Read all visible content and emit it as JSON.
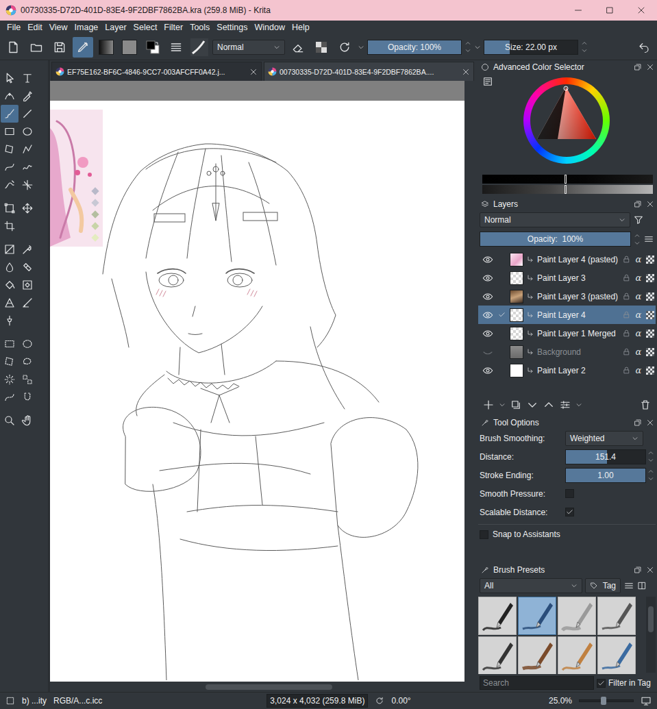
{
  "window": {
    "title": "00730335-D72D-401D-83E4-9F2DBF7862BA.kra (259.8 MiB) - Krita"
  },
  "menu": [
    "File",
    "Edit",
    "View",
    "Image",
    "Layer",
    "Select",
    "Filter",
    "Tools",
    "Settings",
    "Window",
    "Help"
  ],
  "toolbar": {
    "brush_editor_open": true,
    "blend_mode": "Normal",
    "opacity": {
      "label": "Opacity: 100%",
      "level": 1
    },
    "size": {
      "label": "Size: 22.00 px",
      "level": 0.27
    }
  },
  "toolbox": [
    [
      {
        "selected": false
      },
      {
        "selected": false
      },
      {
        "selected": false
      },
      {
        "selected": false
      },
      {
        "selected": true
      },
      {
        "selected": false
      },
      {
        "selected": false
      },
      {
        "selected": false
      },
      {
        "selected": false
      },
      {
        "selected": false
      },
      {
        "selected": false
      },
      {
        "selected": false
      },
      {
        "selected": false
      },
      {
        "selected": false
      }
    ],
    [
      {
        "selected": false
      },
      {
        "selected": false
      },
      {
        "selected": false
      }
    ],
    [
      {
        "selected": false
      },
      {
        "selected": false
      },
      {
        "selected": false
      },
      {
        "selected": false
      },
      {
        "selected": false
      },
      {
        "selected": false
      },
      {
        "selected": false
      },
      {
        "selected": false
      },
      {
        "selected": false
      }
    ],
    [
      {
        "selected": false
      },
      {
        "selected": false
      },
      {
        "selected": false
      },
      {
        "selected": false
      },
      {
        "selected": false
      },
      {
        "selected": false
      },
      {
        "selected": false
      },
      {
        "selected": false
      }
    ],
    [
      {
        "selected": false
      },
      {
        "selected": false
      }
    ]
  ],
  "tabs": [
    {
      "label": "EF75E162-BF6C-4846-9CC7-003AFCFF0A42.j...",
      "selected": false
    },
    {
      "label": "00730335-D72D-401D-83E4-9F2DBF7862BA....",
      "selected": true
    }
  ],
  "color_selector": {
    "title": "Advanced Color Selector"
  },
  "layers": {
    "title": "Layers",
    "blend_mode": "Normal",
    "opacity": {
      "label": "Opacity:  100%",
      "level": 1
    },
    "alpha_glyph": "α",
    "items": [
      {
        "name": "Paint Layer 4 (pasted)",
        "visible": true,
        "selected": false,
        "checked": false,
        "kind": "art"
      },
      {
        "name": "Paint Layer 3",
        "visible": true,
        "selected": false,
        "checked": false,
        "kind": "empty"
      },
      {
        "name": "Paint Layer 3 (pasted)",
        "visible": true,
        "selected": false,
        "checked": false,
        "kind": "photo"
      },
      {
        "name": "Paint Layer 4",
        "visible": true,
        "selected": true,
        "checked": true,
        "kind": "empty"
      },
      {
        "name": "Paint Layer 1 Merged",
        "visible": true,
        "selected": false,
        "checked": false,
        "kind": "empty"
      },
      {
        "name": "Background",
        "visible": false,
        "selected": false,
        "checked": false,
        "kind": "gray"
      },
      {
        "name": "Paint Layer 2",
        "visible": true,
        "selected": false,
        "checked": false,
        "kind": "white"
      }
    ]
  },
  "tool_options": {
    "title": "Tool Options",
    "rows": [
      {
        "kind": "select",
        "label": "Brush Smoothing:",
        "value": "Weighted"
      },
      {
        "kind": "slider",
        "label": "Distance:",
        "value": "151.4",
        "level": 0.52
      },
      {
        "kind": "slider",
        "label": "Stroke Ending:",
        "value": "1.00",
        "level": 1
      },
      {
        "kind": "checkbox",
        "label": "Smooth Pressure:",
        "checked": false
      },
      {
        "kind": "checkbox",
        "label": "Scalable Distance:",
        "checked": true
      }
    ],
    "snap": {
      "label": "Snap to Assistants",
      "checked": false
    }
  },
  "brush_presets": {
    "title": "Brush Presets",
    "filter": "All",
    "tag": "Tag",
    "brushes": [
      {
        "selected": false
      },
      {
        "selected": true
      },
      {
        "selected": false
      },
      {
        "selected": false
      },
      {
        "selected": false
      },
      {
        "selected": false
      },
      {
        "selected": false
      },
      {
        "selected": false
      }
    ],
    "search_placeholder": "Search",
    "filter_in_tag": {
      "label": "Filter in Tag",
      "checked": true
    }
  },
  "status_bar": {
    "items": [
      "b) ...ity",
      "RGB/A...c.icc"
    ],
    "dimensions": "3,024 x 4,032 (259.8 MiB)",
    "rotation": "0.00°",
    "zoom": "25.0%",
    "zoom_level": 0.45
  }
}
